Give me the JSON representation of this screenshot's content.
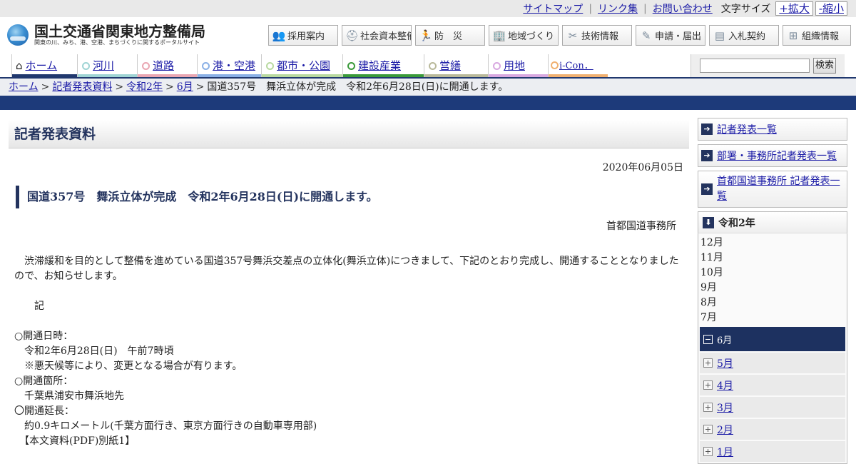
{
  "utility": {
    "sitemap": "サイトマップ",
    "links": "リンク集",
    "contact": "お問い合わせ",
    "font_size_label": "文字サイズ",
    "enlarge": "+拡大",
    "shrink": "-縮小"
  },
  "logo": {
    "title": "国土交通省関東地方整備局",
    "subtitle": "関東の川、みち、港、空港、まちづくりに関するポータルサイト"
  },
  "global_nav": [
    {
      "label": "採用案内",
      "icon": "people-icon"
    },
    {
      "label": "社会資本整備",
      "icon": "helmet-icon"
    },
    {
      "label": "防　災",
      "icon": "runner-icon"
    },
    {
      "label": "地域づくり",
      "icon": "building-icon"
    },
    {
      "label": "技術情報",
      "icon": "tools-icon"
    },
    {
      "label": "申請・届出",
      "icon": "form-icon"
    },
    {
      "label": "入札契約",
      "icon": "document-icon"
    },
    {
      "label": "組織情報",
      "icon": "org-chart-icon"
    }
  ],
  "categories": [
    {
      "label": "ホーム",
      "color": "#20386e"
    },
    {
      "label": "河川",
      "color": "#9fd4d4"
    },
    {
      "label": "道路",
      "color": "#e9a6b2"
    },
    {
      "label": "港・空港",
      "color": "#8ab0e6"
    },
    {
      "label": "都市・公園",
      "color": "#b8d9a0"
    },
    {
      "label": "建設産業",
      "color": "#3a9a3a"
    },
    {
      "label": "営繕",
      "color": "#b9b99a"
    },
    {
      "label": "用地",
      "color": "#d8a8e0"
    },
    {
      "label": "i-Con．",
      "color": "#f0b070"
    }
  ],
  "search": {
    "placeholder": "",
    "button": "検索"
  },
  "breadcrumb": {
    "home": "ホーム",
    "press": "記者発表資料",
    "year": "令和2年",
    "month": "6月",
    "current": "国道357号　舞浜立体が完成　令和2年6月28日(日)に開通します。"
  },
  "main": {
    "section_title": "記者発表資料",
    "date": "2020年06月05日",
    "title": "国道357号　舞浜立体が完成　令和2年6月28日(日)に開通します。",
    "office": "首都国道事務所",
    "lines": [
      "　渋滞緩和を目的として整備を進めている国道357号舞浜交差点の立体化(舞浜立体)につきまして、下記のとおり完成し、開通することとなりましたので、お知らせします。",
      "",
      "　　記",
      "",
      "○開通日時：",
      "　令和2年6月28日(日)　午前7時頃",
      "　※悪天候等により、変更となる場合が有ります。",
      "○開通箇所：",
      "　千葉県浦安市舞浜地先",
      "〇開通延長：",
      "　約0.9キロメートル(千葉方面行き、東京方面行きの自動車専用部)",
      "　【本文資料(PDF)別紙1】"
    ]
  },
  "sidebar": {
    "links": [
      "記者発表一覧",
      "部署・事務所記者発表一覧",
      "首都国道事務所 記者発表一覧"
    ],
    "year": "令和2年",
    "months_plain": [
      "12月",
      "11月",
      "10月",
      "9月",
      "8月",
      "7月"
    ],
    "month_active": "6月",
    "months_expandable": [
      "5月",
      "4月",
      "3月",
      "2月",
      "1月"
    ]
  }
}
